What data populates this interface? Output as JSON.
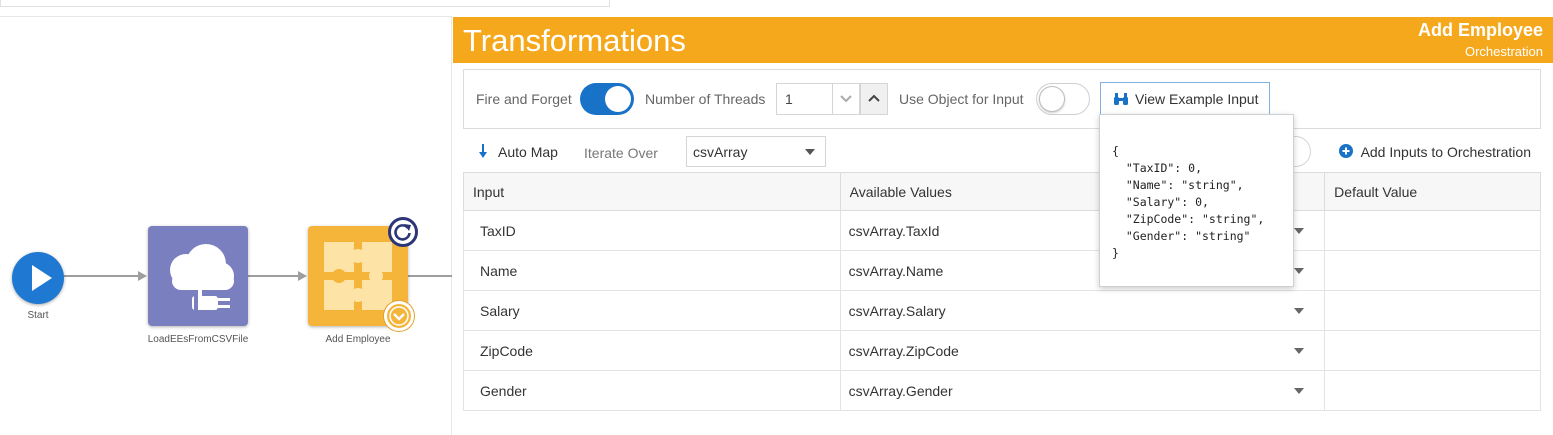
{
  "canvas": {
    "nodes": [
      {
        "label": "Start",
        "icon": "play-icon"
      },
      {
        "label": "LoadEEsFromCSVFile",
        "icon": "cloud-plug-icon"
      },
      {
        "label": "Add Employee",
        "icon": "puzzle-icon"
      }
    ]
  },
  "panel": {
    "title": "Transformations",
    "entity_name": "Add Employee",
    "entity_type": "Orchestration",
    "header_color": "#f5a81c"
  },
  "options": {
    "fire_and_forget_label": "Fire and Forget",
    "fire_and_forget_on": true,
    "threads_label": "Number of Threads",
    "threads_value": "1",
    "use_object_label": "Use Object for Input",
    "use_object_on": false,
    "view_example_label": "View Example Input"
  },
  "toolbar": {
    "auto_map_label": "Auto Map",
    "iterate_over_label": "Iterate Over",
    "iterate_over_value": "csvArray",
    "add_inputs_label": "Add Inputs to Orchestration"
  },
  "table": {
    "columns": [
      "Input",
      "Available Values",
      "Default Value"
    ],
    "rows": [
      {
        "input": "TaxID",
        "available": "csvArray.TaxId",
        "default": ""
      },
      {
        "input": "Name",
        "available": "csvArray.Name",
        "default": ""
      },
      {
        "input": "Salary",
        "available": "csvArray.Salary",
        "default": ""
      },
      {
        "input": "ZipCode",
        "available": "csvArray.ZipCode",
        "default": ""
      },
      {
        "input": "Gender",
        "available": "csvArray.Gender",
        "default": ""
      }
    ]
  },
  "example_input": {
    "json_text": "{\n  \"TaxID\": 0,\n  \"Name\": \"string\",\n  \"Salary\": 0,\n  \"ZipCode\": \"string\",\n  \"Gender\": \"string\"\n}"
  },
  "colors": {
    "accent_blue": "#1872c8",
    "start_node": "#1f78d1",
    "load_node": "#7a7fc0",
    "orchestration_node": "#f5b53a"
  }
}
